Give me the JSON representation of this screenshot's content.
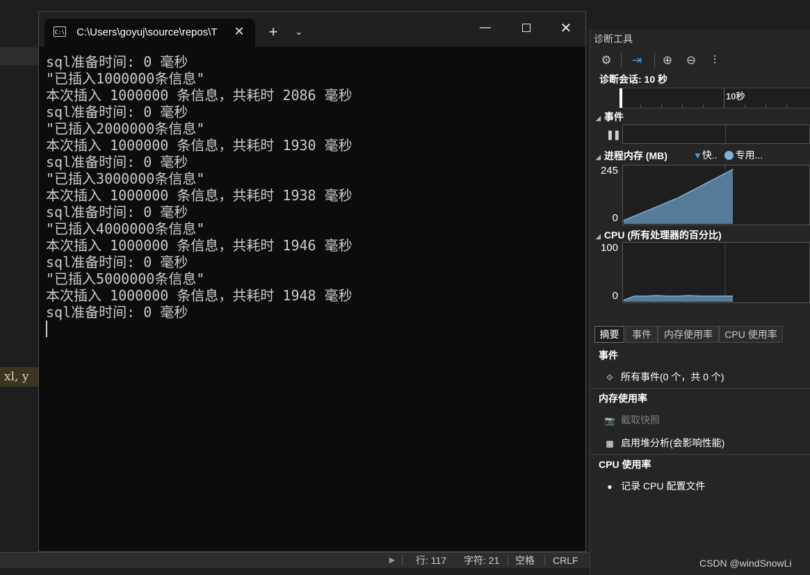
{
  "editor": {
    "snippet": "xl, y"
  },
  "statusbar": {
    "line": "行: 117",
    "char": "字符: 21",
    "spaces": "空格",
    "eol": "CRLF"
  },
  "terminal": {
    "tab_title": "C:\\Users\\goyuj\\source\\repos\\T",
    "tab_icon": "C:\\",
    "new_tab": "+",
    "lines": [
      "sql准备时间: 0 毫秒",
      "\"已插入1000000条信息\"",
      "本次插入 1000000 条信息，共耗时 2086 毫秒",
      "sql准备时间: 0 毫秒",
      "\"已插入2000000条信息\"",
      "本次插入 1000000 条信息，共耗时 1930 毫秒",
      "sql准备时间: 0 毫秒",
      "\"已插入3000000条信息\"",
      "本次插入 1000000 条信息，共耗时 1938 毫秒",
      "sql准备时间: 0 毫秒",
      "\"已插入4000000条信息\"",
      "本次插入 1000000 条信息，共耗时 1946 毫秒",
      "sql准备时间: 0 毫秒",
      "\"已插入5000000条信息\"",
      "本次插入 1000000 条信息，共耗时 1948 毫秒",
      "sql准备时间: 0 毫秒"
    ]
  },
  "diagnostics": {
    "title": "诊断工具",
    "session": "诊断会话: 10 秒",
    "timeline_label": "10秒",
    "events_header": "事件",
    "memory_header": "进程内存 (MB)",
    "memory_legend_snapshot": "快..",
    "memory_legend_private": "专用...",
    "memory_ymax": "245",
    "memory_ymin": "0",
    "cpu_header": "CPU (所有处理器的百分比)",
    "cpu_ymax": "100",
    "cpu_ymin": "0",
    "tabs": [
      "摘要",
      "事件",
      "内存使用率",
      "CPU 使用率"
    ],
    "sections": {
      "events": "事件",
      "all_events": "所有事件(0 个，共 0 个)",
      "memory": "内存使用率",
      "snapshot": "截取快照",
      "heap": "启用堆分析(会影响性能)",
      "cpu": "CPU 使用率",
      "cpu_profile": "记录 CPU 配置文件"
    },
    "colors": {
      "memory_fill": "#557b96",
      "memory_line": "#7fb0d8"
    }
  },
  "watermark": "CSDN @windSnowLi",
  "chart_data": [
    {
      "type": "area",
      "title": "进程内存 (MB)",
      "ylim": [
        0,
        245
      ],
      "x": [
        0,
        1,
        2,
        3,
        4,
        5,
        6,
        7,
        8,
        9,
        10
      ],
      "series": [
        {
          "name": "专用...",
          "values": [
            15,
            35,
            55,
            75,
            95,
            115,
            140,
            165,
            190,
            215,
            240
          ]
        }
      ]
    },
    {
      "type": "area",
      "title": "CPU (所有处理器的百分比)",
      "ylim": [
        0,
        100
      ],
      "x": [
        0,
        1,
        2,
        3,
        4,
        5,
        6,
        7,
        8,
        9,
        10
      ],
      "series": [
        {
          "values": [
            3,
            10,
            10,
            11,
            10,
            10,
            11,
            10,
            10,
            10,
            10
          ]
        }
      ]
    }
  ]
}
